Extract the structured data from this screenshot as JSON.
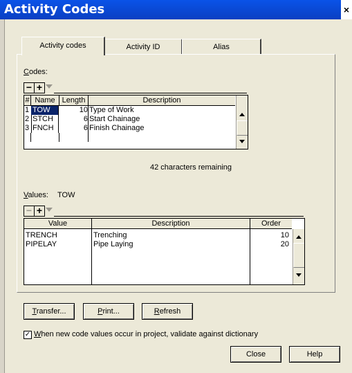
{
  "window": {
    "title": "Activity Codes",
    "close_glyph": "×"
  },
  "tabs": [
    {
      "label": "Activity codes",
      "active": true
    },
    {
      "label": "Activity ID",
      "active": false
    },
    {
      "label": "Alias",
      "active": false
    }
  ],
  "codes": {
    "label": "Codes:",
    "toolbar": {
      "minus": "−",
      "plus": "+"
    },
    "columns": [
      "#",
      "Name",
      "Length",
      "Description"
    ],
    "rows": [
      {
        "num": "1",
        "name": "TOW",
        "length": "10",
        "description": "Type of Work",
        "selected": true
      },
      {
        "num": "2",
        "name": "STCH",
        "length": "6",
        "description": "Start Chainage",
        "selected": false
      },
      {
        "num": "3",
        "name": "FNCH",
        "length": "6",
        "description": "Finish Chainage",
        "selected": false
      }
    ],
    "remaining": "42 characters remaining"
  },
  "values": {
    "label": "Values:",
    "code": "TOW",
    "toolbar": {
      "minus": "−",
      "plus": "+"
    },
    "columns": [
      "Value",
      "Description",
      "Order"
    ],
    "rows": [
      {
        "value": "TRENCH",
        "description": "Trenching",
        "order": "10"
      },
      {
        "value": "PIPELAY",
        "description": "Pipe Laying",
        "order": "20"
      }
    ]
  },
  "buttons": {
    "transfer": "Transfer...",
    "print": "Print...",
    "refresh": "Refresh",
    "close": "Close",
    "help": "Help"
  },
  "validate": {
    "checked": true,
    "check_glyph": "✓",
    "label": "When new code values occur in project, validate against dictionary"
  }
}
